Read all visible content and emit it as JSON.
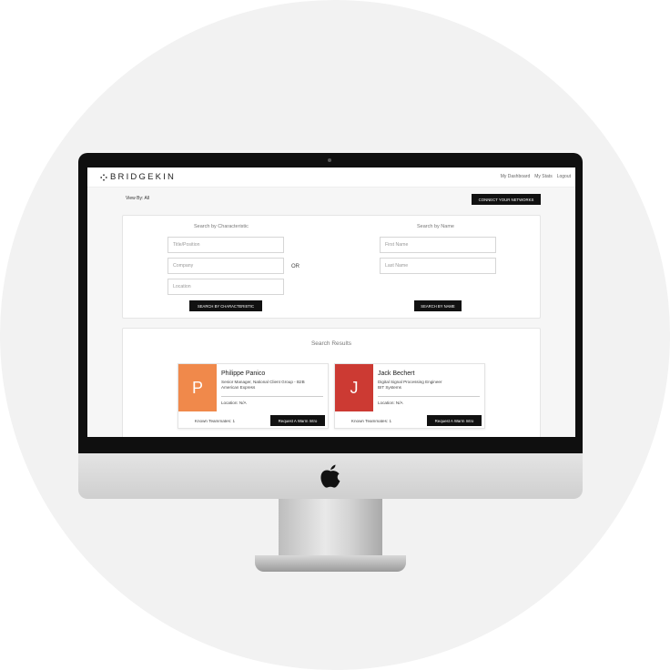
{
  "app": {
    "brand": "BRIDGEKIN",
    "nav": [
      "My Dashboard",
      "My Stats",
      "Logout"
    ]
  },
  "toolbar": {
    "view_by": "View By: All",
    "connect_label": "CONNECT YOUR NETWORKS"
  },
  "search": {
    "characteristic": {
      "title": "Search by Characteristic",
      "fields": [
        {
          "placeholder": "Title/Position",
          "value": ""
        },
        {
          "placeholder": "Company",
          "value": ""
        },
        {
          "placeholder": "Location",
          "value": ""
        }
      ],
      "button": "SEARCH BY CHARACTERISTIC"
    },
    "or_label": "OR",
    "name": {
      "title": "Search by Name",
      "fields": [
        {
          "placeholder": "First Name",
          "value": ""
        },
        {
          "placeholder": "Last Name",
          "value": ""
        }
      ],
      "button": "SEARCH BY NAME"
    }
  },
  "results": {
    "title": "Search Results",
    "cards": [
      {
        "initial": "P",
        "avatar_color": "#f0894b",
        "name": "Philippe Panico",
        "title_line": "Senior Manager, National Client Group - B2B",
        "company": "American Express",
        "location": "Location: N/A",
        "teammates": "Known Teammates: 1",
        "button": "Request A Warm Intro"
      },
      {
        "initial": "J",
        "avatar_color": "#cc3a33",
        "name": "Jack Bechert",
        "title_line": "Digital Signal Processing Engineer",
        "company": "BIT Systems",
        "location": "Location: N/A",
        "teammates": "Known Teammates: 1",
        "button": "Request A Warm Intro"
      }
    ]
  }
}
